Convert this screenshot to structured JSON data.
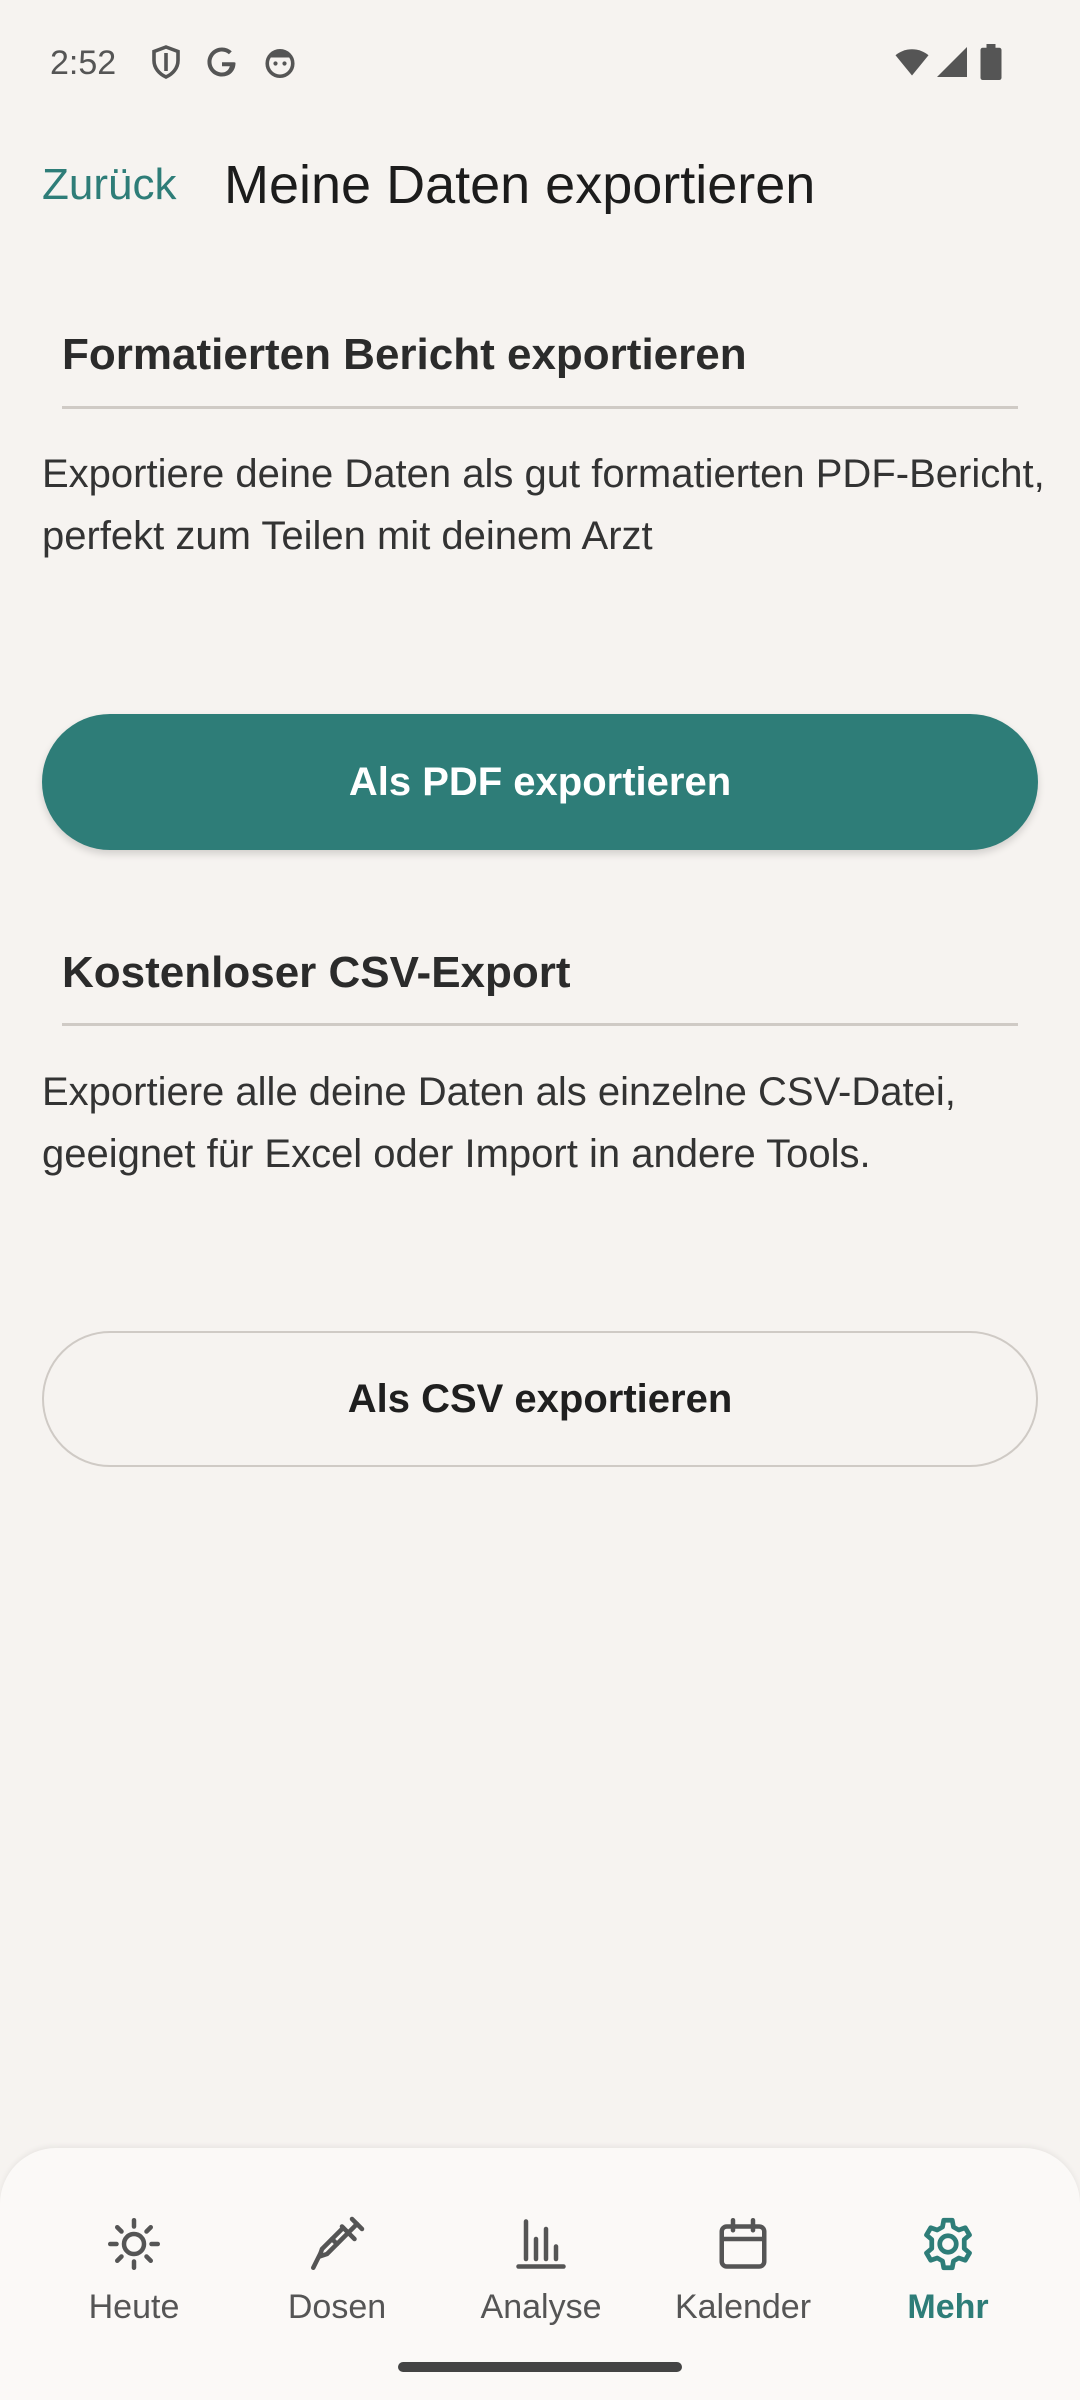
{
  "status_bar": {
    "time": "2:52",
    "left_icons": [
      "shield-icon",
      "google-icon",
      "face-icon"
    ],
    "right_icons": [
      "wifi-icon",
      "signal-icon",
      "battery-icon"
    ]
  },
  "header": {
    "back_label": "Zurück",
    "title": "Meine Daten exportieren"
  },
  "sections": [
    {
      "title": "Formatierten Bericht exportieren",
      "description": "Exportiere deine Daten als gut formatierten PDF-Bericht, perfekt zum Teilen mit deinem Arzt",
      "button_label": "Als PDF exportieren"
    },
    {
      "title": "Kostenloser CSV-Export",
      "description": "Exportiere alle deine Daten als einzelne CSV-Datei, geeignet für Excel oder Import in andere Tools.",
      "button_label": "Als CSV exportieren"
    }
  ],
  "bottom_nav": {
    "items": [
      {
        "label": "Heute",
        "icon": "sun-icon"
      },
      {
        "label": "Dosen",
        "icon": "syringe-icon"
      },
      {
        "label": "Analyse",
        "icon": "bar-chart-icon"
      },
      {
        "label": "Kalender",
        "icon": "calendar-icon"
      },
      {
        "label": "Mehr",
        "icon": "gear-icon",
        "active": true
      }
    ]
  },
  "colors": {
    "accent": "#2e7d78",
    "background": "#f6f3f0"
  }
}
